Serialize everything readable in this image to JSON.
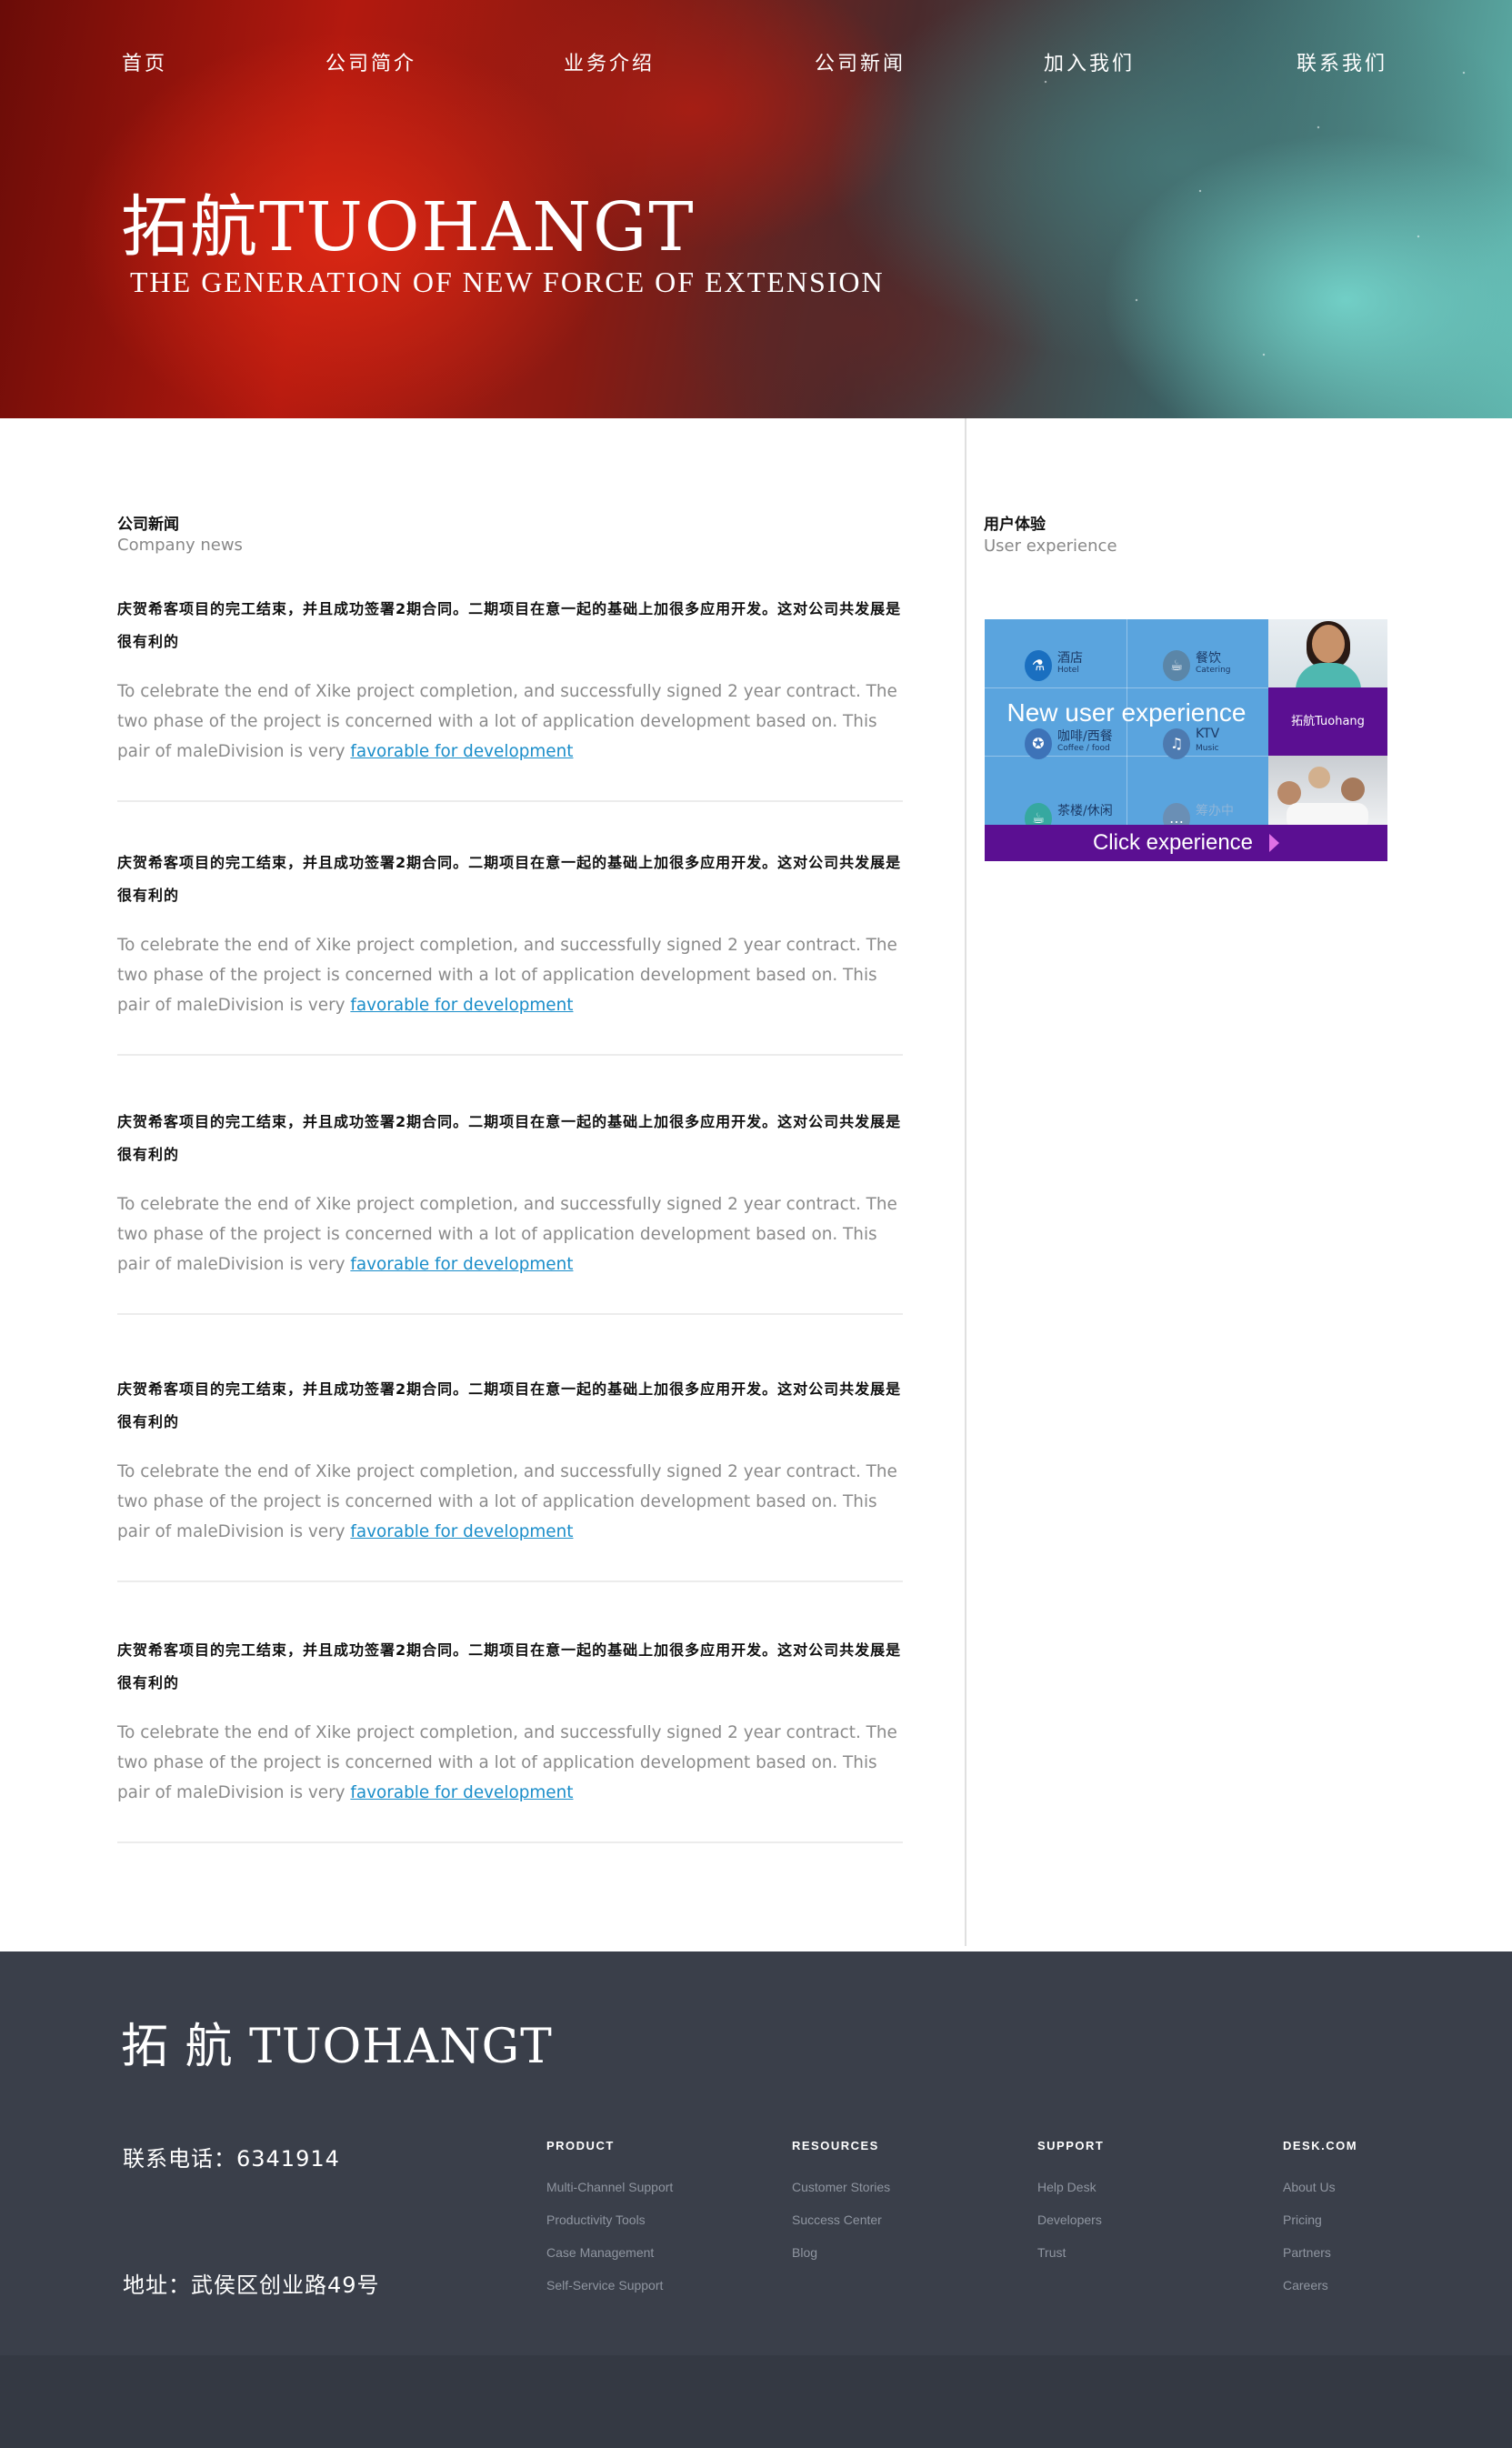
{
  "nav": {
    "items": [
      {
        "label": "首页"
      },
      {
        "label": "公司简介"
      },
      {
        "label": "业务介绍"
      },
      {
        "label": "公司新闻"
      },
      {
        "label": "加入我们"
      },
      {
        "label": "联系我们"
      }
    ]
  },
  "hero": {
    "title": "拓航TUOHANGT",
    "subtitle": "THE GENERATION OF NEW FORCE OF EXTENSION"
  },
  "news_section": {
    "title_cn": "公司新闻",
    "title_en": "Company news",
    "items": [
      {
        "title": "庆贺希客项目的完工结束，并且成功签署2期合同。二期项目在意一起的基础上加很多应用开发。这对公司共发展是很有利的",
        "body": "To celebrate the end of Xike project completion, and successfully signed 2 year contract.   The two phase of the project is concerned with a lot of application development based on. This pair of maleDivision is very ",
        "link": "favorable for development"
      },
      {
        "title": "庆贺希客项目的完工结束，并且成功签署2期合同。二期项目在意一起的基础上加很多应用开发。这对公司共发展是很有利的",
        "body": "To celebrate the end of Xike project completion, and successfully signed 2 year contract.   The two phase of the project is concerned with a lot of application development based on. This pair of maleDivision is very ",
        "link": "favorable for development"
      },
      {
        "title": "庆贺希客项目的完工结束，并且成功签署2期合同。二期项目在意一起的基础上加很多应用开发。这对公司共发展是很有利的",
        "body": "To celebrate the end of Xike project completion, and successfully signed 2 year contract.   The two phase of the project is concerned with a lot of application development based on. This pair of maleDivision is very ",
        "link": "favorable for development"
      },
      {
        "title": "庆贺希客项目的完工结束，并且成功签署2期合同。二期项目在意一起的基础上加很多应用开发。这对公司共发展是很有利的",
        "body": "To celebrate the end of Xike project completion, and successfully signed 2 year contract.   The two phase of the project is concerned with a lot of application development based on. This pair of maleDivision is very ",
        "link": "favorable for development"
      },
      {
        "title": "庆贺希客项目的完工结束，并且成功签署2期合同。二期项目在意一起的基础上加很多应用开发。这对公司共发展是很有利的",
        "body": "To celebrate the end of Xike project completion, and successfully signed 2 year contract.   The two phase of the project is concerned with a lot of application development based on. This pair of maleDivision is very ",
        "link": "favorable for development"
      }
    ]
  },
  "sidebar": {
    "title_cn": "用户体验",
    "title_en": "User experience",
    "banner": {
      "headline": "New user experience",
      "cta": "Click experience",
      "brand_tile": "拓航Tuohang",
      "tiles": [
        {
          "cn": "酒店",
          "en": "Hotel",
          "icon": "hotel-icon"
        },
        {
          "cn": "餐饮",
          "en": "Catering",
          "icon": "catering-icon"
        },
        {
          "cn": "咖啡/西餐",
          "en": "Coffee / food",
          "icon": "coffee-icon"
        },
        {
          "cn": "KTV",
          "en": "Music",
          "icon": "music-icon"
        },
        {
          "cn": "茶楼/休闲",
          "en": "",
          "icon": "tea-icon"
        },
        {
          "cn": "筹办中",
          "en": "",
          "icon": "pending-icon"
        }
      ]
    }
  },
  "footer": {
    "logo": "拓 航 TUOHANGT",
    "phone": "联系电话：6341914",
    "address": "地址：武侯区创业路49号",
    "columns": [
      {
        "heading": "PRODUCT",
        "links": [
          "Multi-Channel Support",
          "Productivity Tools",
          "Case Management",
          "Self-Service Support"
        ]
      },
      {
        "heading": "RESOURCES",
        "links": [
          "Customer Stories",
          "Success Center",
          "Blog"
        ]
      },
      {
        "heading": "SUPPORT",
        "links": [
          "Help Desk",
          "Developers",
          "Trust"
        ]
      },
      {
        "heading": "DESK.COM",
        "links": [
          "About Us",
          "Pricing",
          "Partners",
          "Careers"
        ]
      }
    ]
  },
  "colors": {
    "accent_link": "#1a8dc9",
    "banner_blue": "#5aa4de",
    "banner_purple": "#5b0f92",
    "footer_bg": "#3a3f4a"
  }
}
